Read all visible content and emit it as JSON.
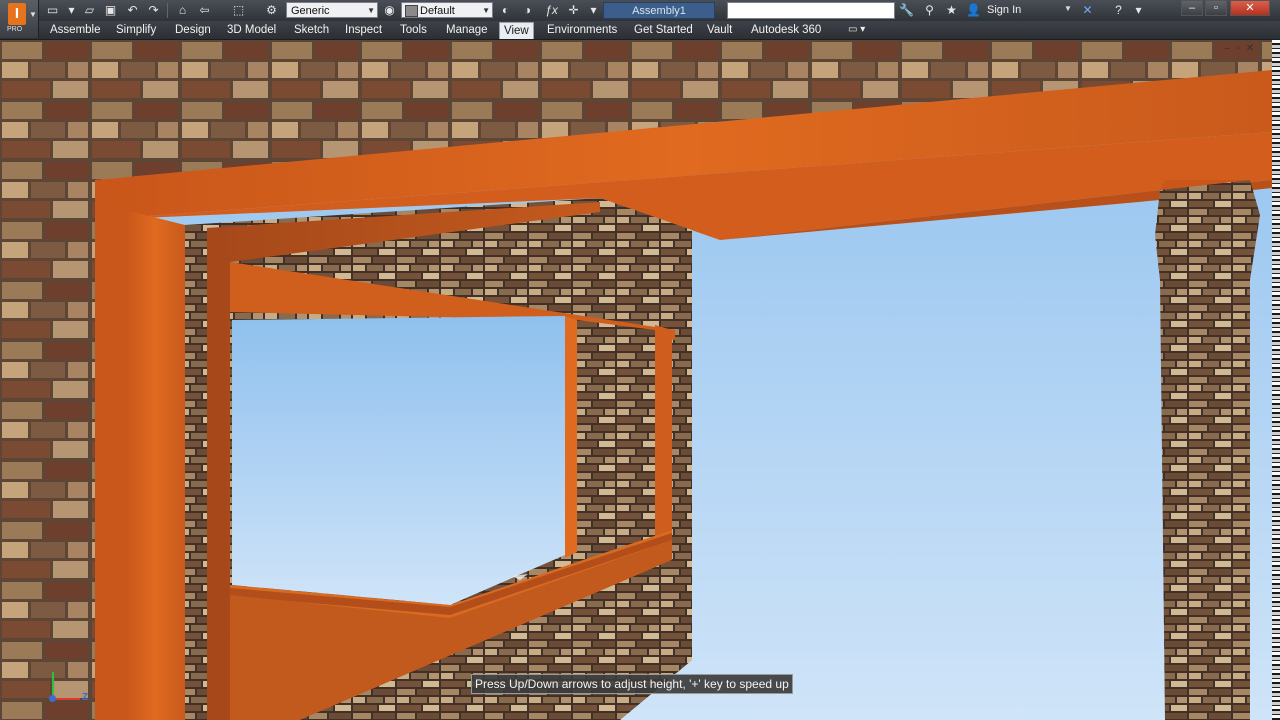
{
  "app": {
    "logo_letter": "I",
    "edition_badge": "PRO",
    "document_title": "Assembly1",
    "search_placeholder": ""
  },
  "quick_access": {
    "icons": [
      "new-icon",
      "open-icon",
      "save-icon",
      "undo-icon",
      "redo-icon",
      "home-icon",
      "return-icon",
      "select-icon",
      "update-icon"
    ],
    "material_combo": "Generic",
    "appearance_combo": "Default",
    "right_icons": [
      "appearance-icon",
      "clear-override-icon",
      "fx-icon",
      "transform-icon"
    ]
  },
  "title_bar": {
    "sign_in": "Sign In",
    "icons": [
      "wrench-icon",
      "magnify-icon",
      "star-icon",
      "user-icon",
      "exchange-icon",
      "help-icon"
    ]
  },
  "ribbon_tabs": [
    {
      "label": "Assemble"
    },
    {
      "label": "Simplify"
    },
    {
      "label": "Design"
    },
    {
      "label": "3D Model"
    },
    {
      "label": "Sketch"
    },
    {
      "label": "Inspect"
    },
    {
      "label": "Tools"
    },
    {
      "label": "Manage"
    },
    {
      "label": "View",
      "active": true
    },
    {
      "label": "Environments"
    },
    {
      "label": "Get Started"
    },
    {
      "label": "Vault"
    },
    {
      "label": "Autodesk 360"
    }
  ],
  "viewport": {
    "triad_axis_label": "Z",
    "status_message": "Press Up/Down arrows to adjust height, '+' key to speed up"
  },
  "colors": {
    "sky": "#9ec8ef",
    "wood": "#d9611a",
    "stone": "#8a6a4c"
  }
}
